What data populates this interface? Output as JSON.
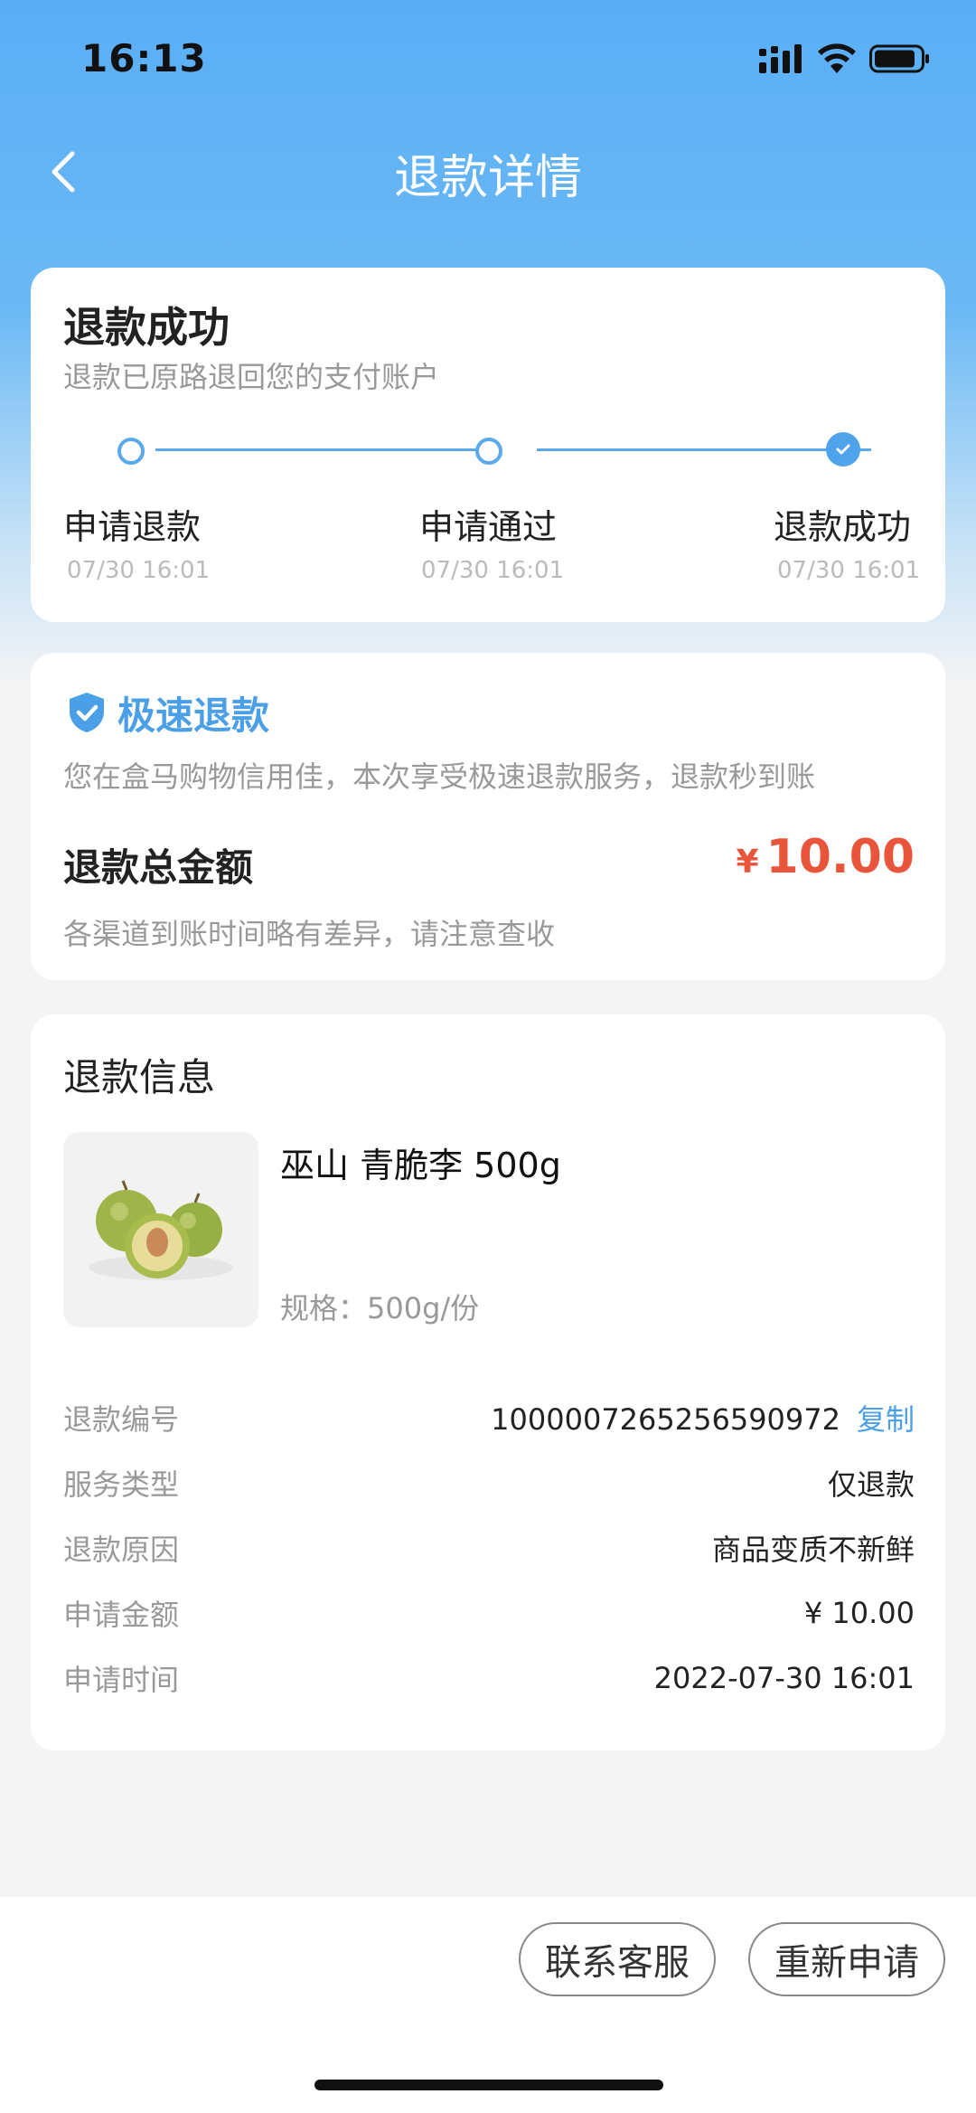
{
  "status_bar": {
    "time": "16:13"
  },
  "nav": {
    "title": "退款详情"
  },
  "status_card": {
    "title": "退款成功",
    "subtitle": "退款已原路退回您的支付账户",
    "steps": [
      {
        "label": "申请退款",
        "time": "07/30 16:01"
      },
      {
        "label": "申请通过",
        "time": "07/30 16:01"
      },
      {
        "label": "退款成功",
        "time": "07/30 16:01"
      }
    ]
  },
  "fast_card": {
    "title": "极速退款",
    "description": "您在盒马购物信用佳，本次享受极速退款服务，退款秒到账",
    "total_label": "退款总金额",
    "currency": "¥",
    "total_amount": "10.00",
    "note": "各渠道到账时间略有差异，请注意查收"
  },
  "info_card": {
    "title": "退款信息",
    "product_name": "巫山 青脆李 500g",
    "product_spec": "规格：500g/份",
    "rows": [
      {
        "key": "退款编号",
        "value": "1000007265256590972"
      },
      {
        "key": "服务类型",
        "value": "仅退款"
      },
      {
        "key": "退款原因",
        "value": "商品变质不新鲜"
      },
      {
        "key": "申请金额",
        "value": "¥ 10.00"
      },
      {
        "key": "申请时间",
        "value": "2022-07-30 16:01"
      }
    ],
    "copy_label": "复制"
  },
  "bottom": {
    "contact_label": "联系客服",
    "reapply_label": "重新申请"
  },
  "colors": {
    "accent_blue": "#4a9fe6",
    "amount_red": "#e8553b"
  }
}
